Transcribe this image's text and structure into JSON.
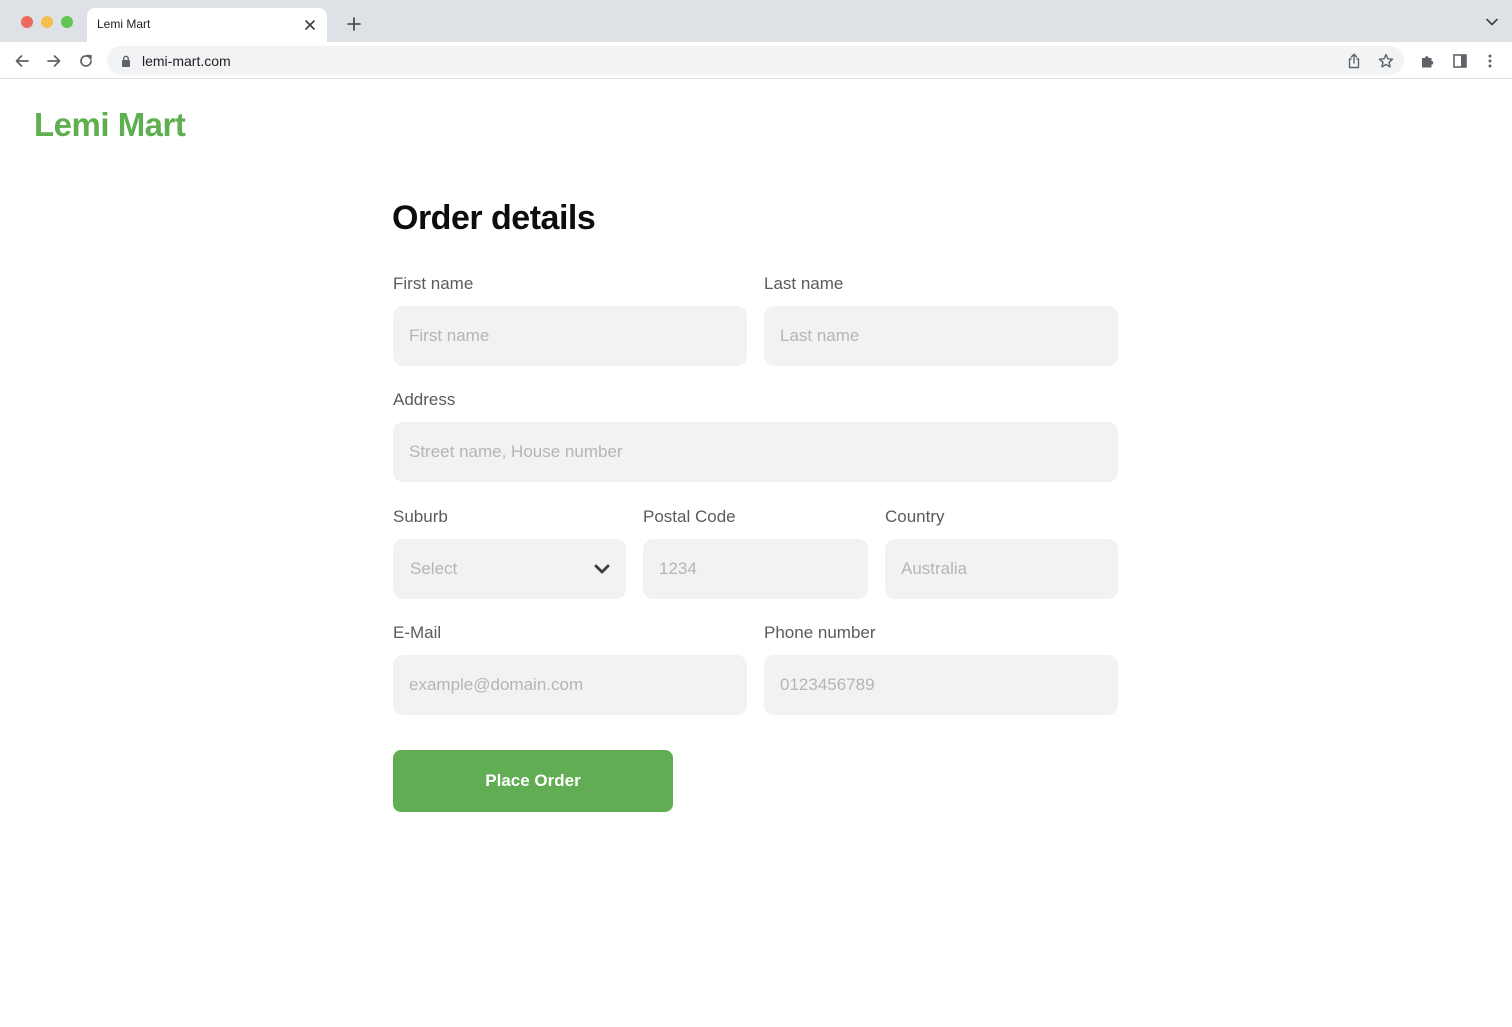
{
  "browser": {
    "tab_title": "Lemi Mart",
    "url": "lemi-mart.com",
    "icons": {
      "tab_close": "close-icon",
      "new_tab": "plus-icon",
      "tab_menu": "chevron-down-icon",
      "back": "arrow-left-icon",
      "forward": "arrow-right-icon",
      "reload": "reload-icon",
      "lock": "lock-icon",
      "share": "share-icon",
      "bookmark": "star-icon",
      "extensions": "puzzle-icon",
      "side_panel": "side-panel-icon",
      "menu": "more-vertical-icon"
    }
  },
  "brand": {
    "logo_text": "Lemi Mart",
    "color": "#5faf51"
  },
  "form": {
    "title": "Order details",
    "first_name": {
      "label": "First name",
      "placeholder": "First name",
      "value": ""
    },
    "last_name": {
      "label": "Last name",
      "placeholder": "Last name",
      "value": ""
    },
    "address": {
      "label": "Address",
      "placeholder": "Street name, House number",
      "value": ""
    },
    "suburb": {
      "label": "Suburb",
      "selected": "Select",
      "icon": "chevron-down-icon"
    },
    "postal_code": {
      "label": "Postal Code",
      "placeholder": "1234",
      "value": ""
    },
    "country": {
      "label": "Country",
      "placeholder": "Australia",
      "value": ""
    },
    "email": {
      "label": "E-Mail",
      "placeholder": "example@domain.com",
      "value": ""
    },
    "phone": {
      "label": "Phone number",
      "placeholder": "0123456789",
      "value": ""
    },
    "submit_label": "Place Order",
    "submit_color": "#61ad53"
  }
}
